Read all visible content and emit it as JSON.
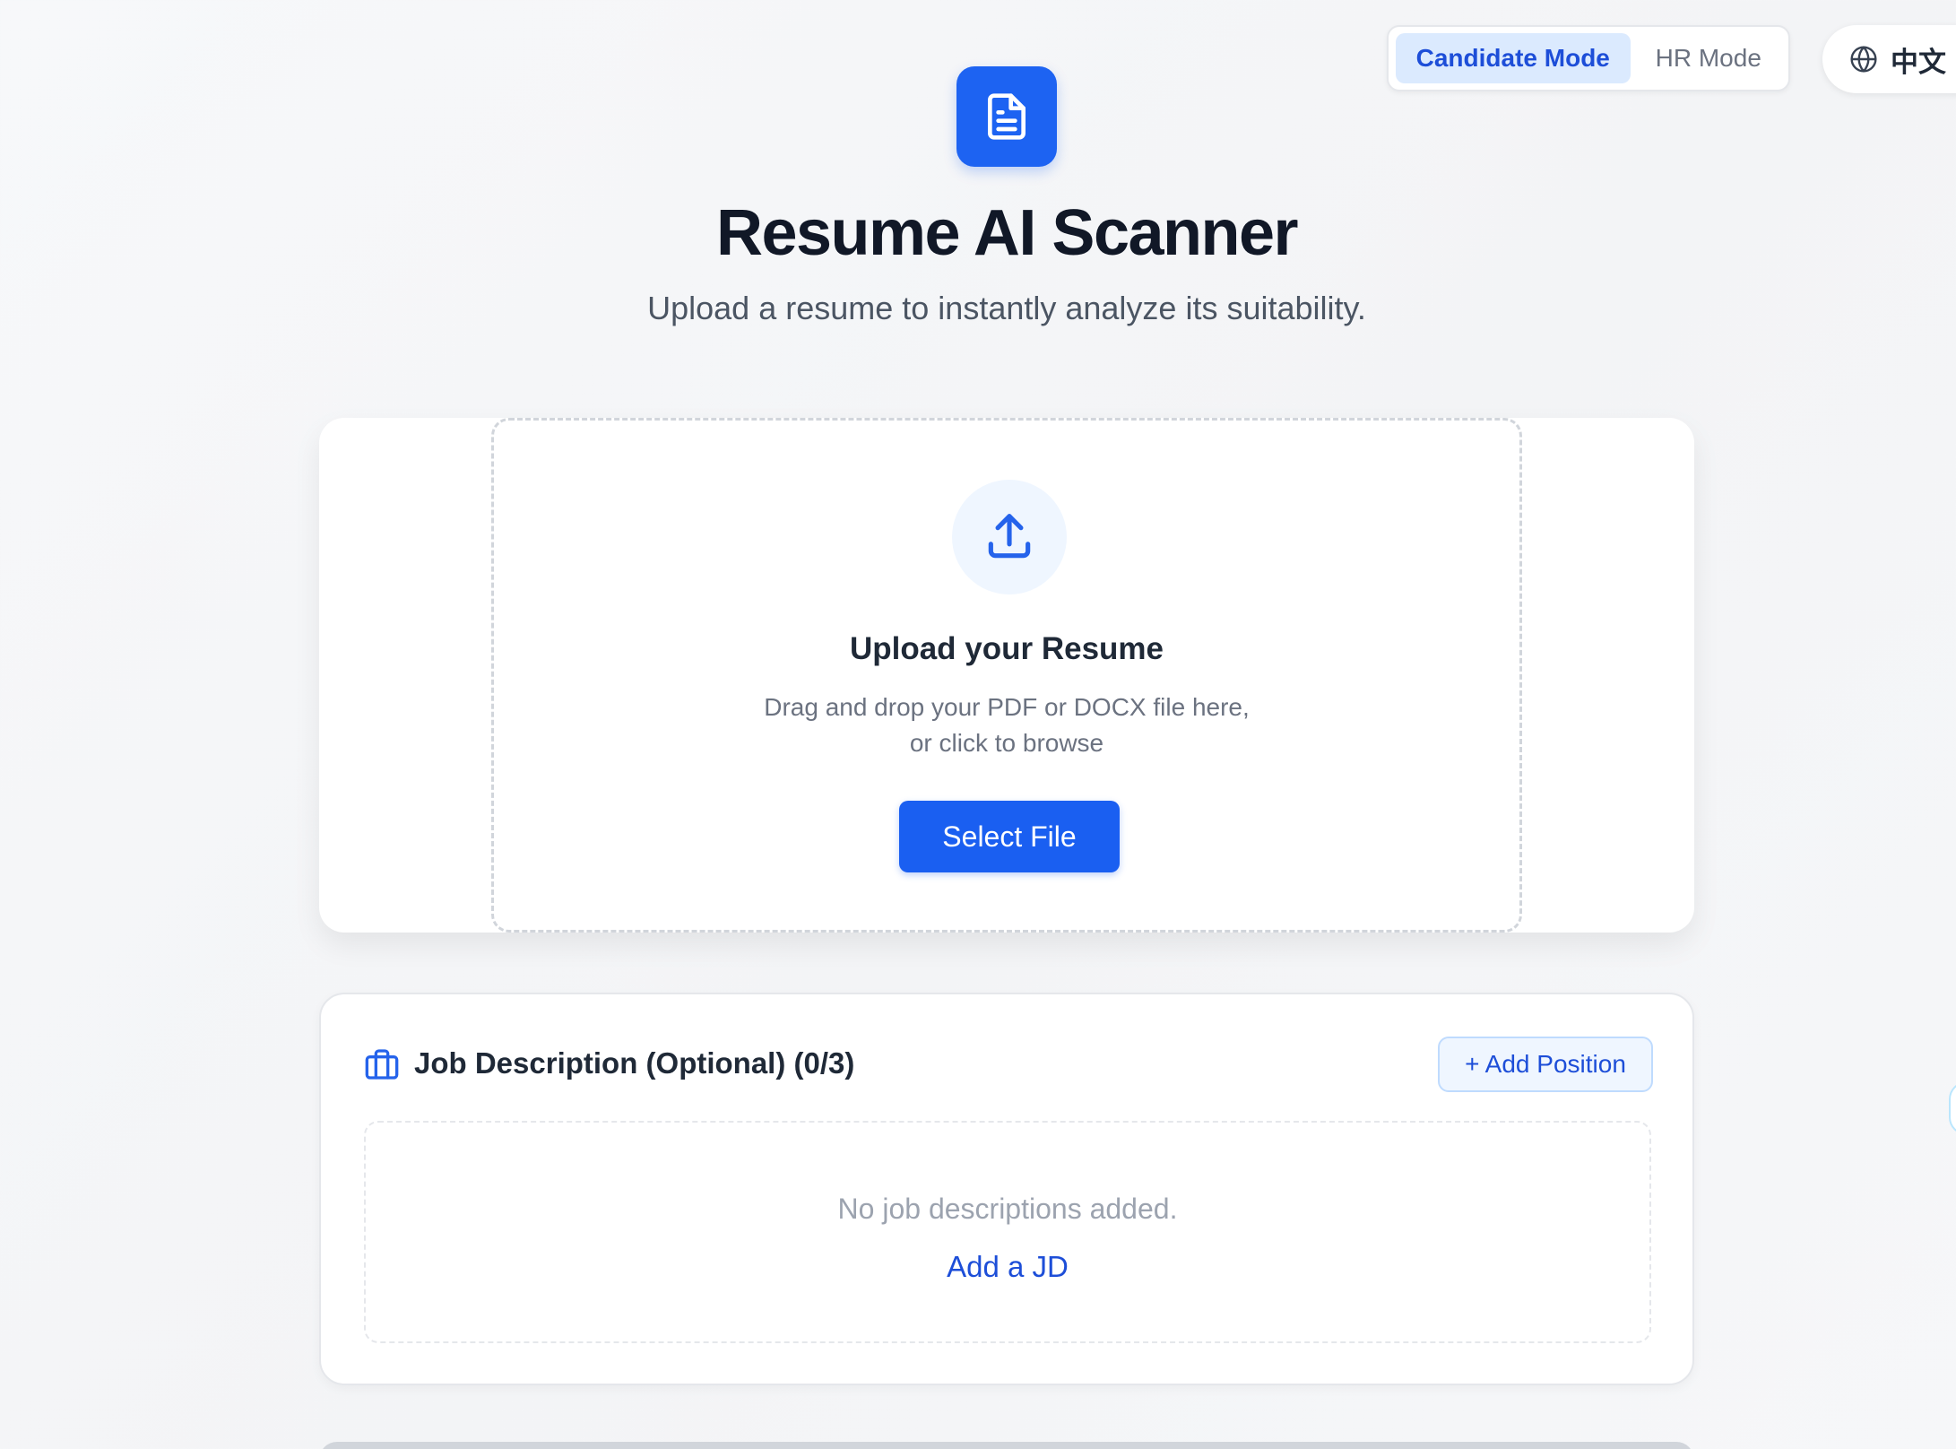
{
  "header": {
    "title": "Resume AI Scanner",
    "subtitle": "Upload a resume to instantly analyze its suitability.",
    "logo_icon": "document-icon"
  },
  "mode_toggle": {
    "candidate_label": "Candidate Mode",
    "hr_label": "HR Mode",
    "active": "candidate"
  },
  "language": {
    "label": "中文",
    "icon": "globe-icon"
  },
  "upload": {
    "icon": "upload-icon",
    "title": "Upload your Resume",
    "description_line1": "Drag and drop your PDF or DOCX file here,",
    "description_line2": "or click to browse",
    "button_label": "Select File"
  },
  "job_description": {
    "icon": "briefcase-icon",
    "title": "Job Description (Optional) (0/3)",
    "add_button_label": "+ Add Position",
    "empty_text": "No job descriptions added.",
    "add_link_label": "Add a JD"
  },
  "colors": {
    "primary": "#1a5ff1",
    "primary_light": "#dbeafe",
    "text_dark": "#111827",
    "text_muted": "#6b7280"
  }
}
